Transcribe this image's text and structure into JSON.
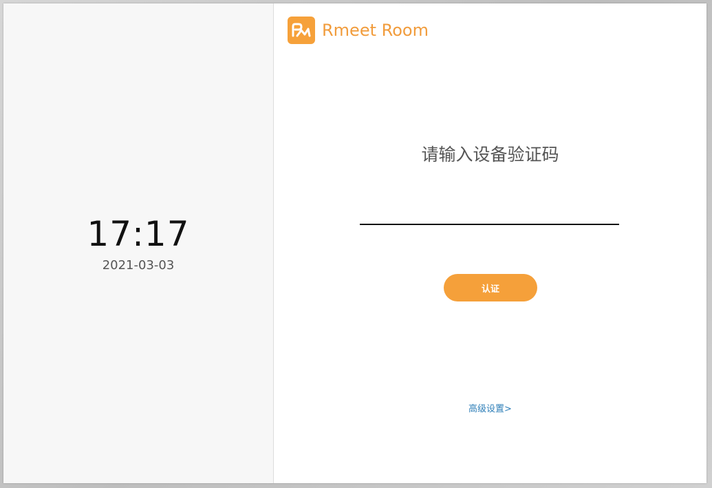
{
  "clock": {
    "time": "17:17",
    "date": "2021-03-03"
  },
  "brand": {
    "logo_icon": "rmeet-logo-icon",
    "name": "Rmeet Room",
    "color": "#f19c3c"
  },
  "verification": {
    "prompt": "请输入设备验证码",
    "input_value": "",
    "submit_label": "认证",
    "button_color": "#f5a03a"
  },
  "advanced": {
    "link_label": "高级设置>",
    "color": "#2f7fb8"
  }
}
